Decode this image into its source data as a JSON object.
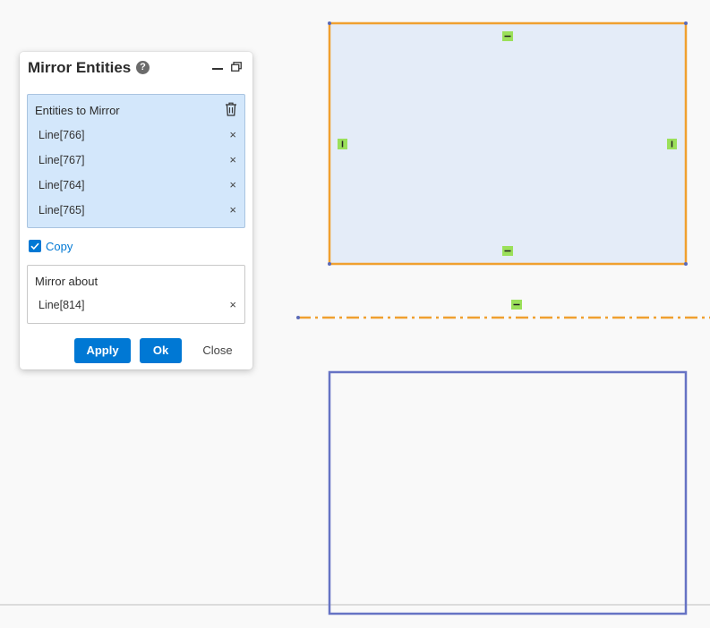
{
  "dialog": {
    "title": "Mirror Entities",
    "help_glyph": "?",
    "entities_section": {
      "label": "Entities to Mirror",
      "items": [
        {
          "label": "Line[766]",
          "remove_glyph": "×"
        },
        {
          "label": "Line[767]",
          "remove_glyph": "×"
        },
        {
          "label": "Line[764]",
          "remove_glyph": "×"
        },
        {
          "label": "Line[765]",
          "remove_glyph": "×"
        }
      ]
    },
    "copy": {
      "label": "Copy",
      "checked": true
    },
    "mirror_about": {
      "label": "Mirror about",
      "item": {
        "label": "Line[814]",
        "remove_glyph": "×"
      }
    },
    "buttons": {
      "apply": "Apply",
      "ok": "Ok",
      "close": "Close"
    }
  },
  "colors": {
    "accent": "#0078d4",
    "selected_entity_stroke": "#f0a030",
    "selected_entity_fill": "#e4ecf8",
    "mirrored_entity_stroke": "#6673c4",
    "constraint_marker": "#9be05a"
  }
}
